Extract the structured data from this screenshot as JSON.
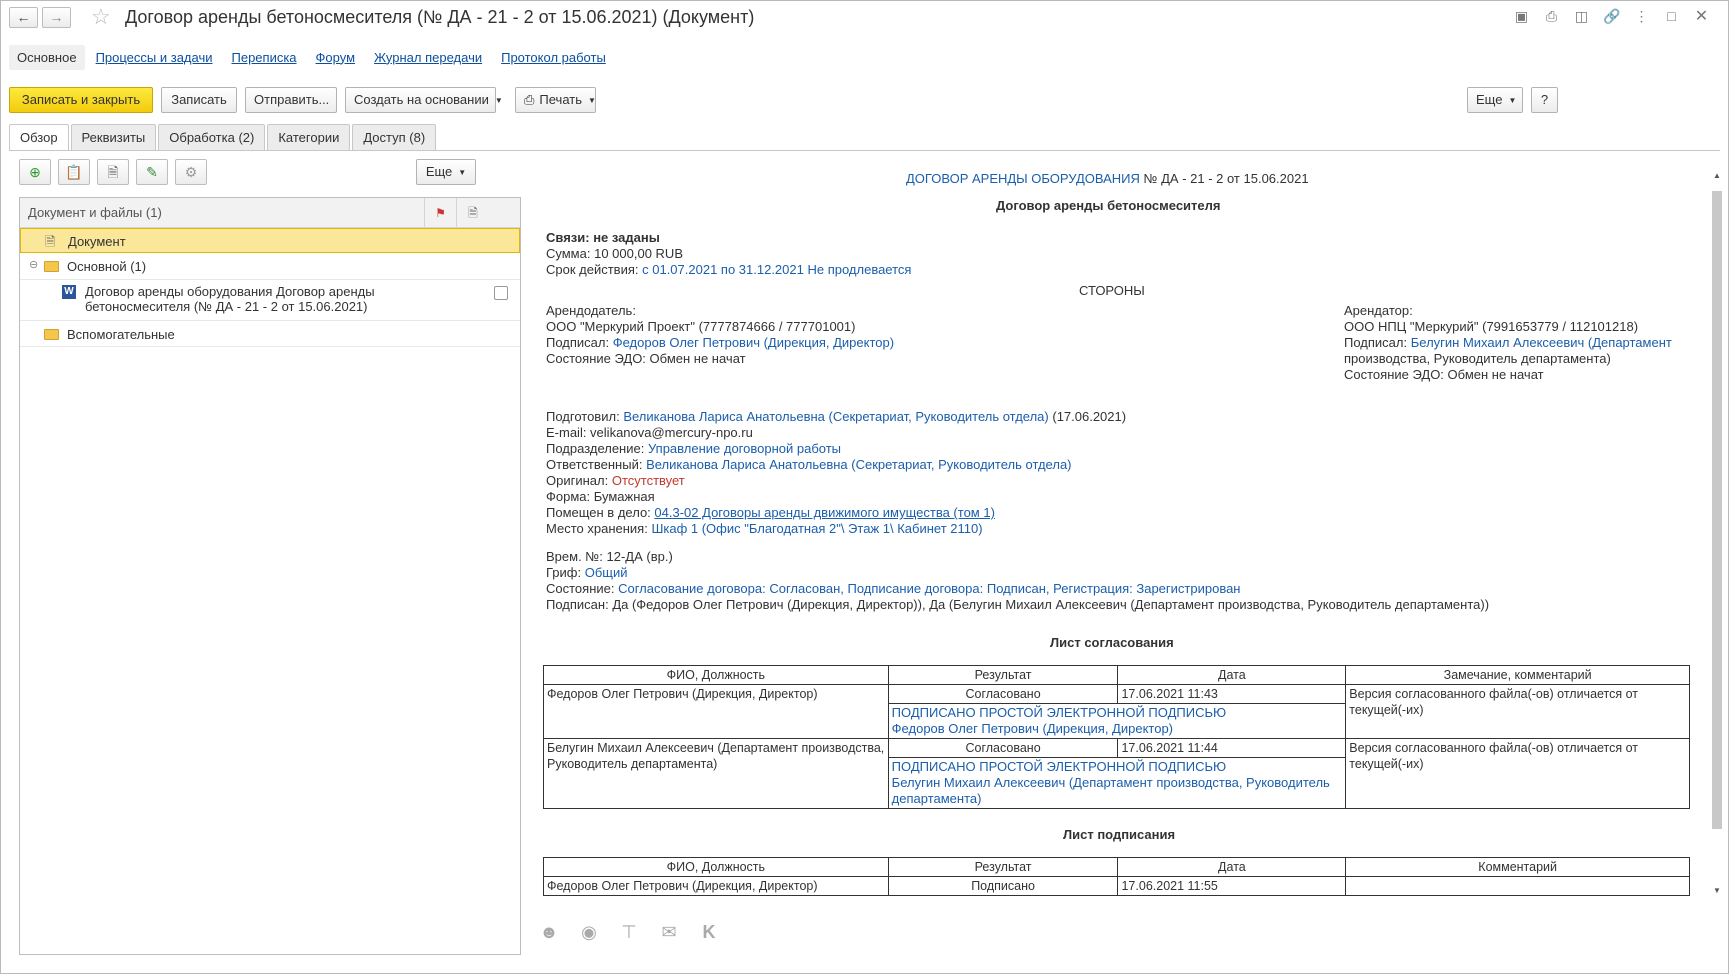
{
  "window": {
    "title": "Договор аренды бетоносмесителя (№ ДА - 21 - 2 от 15.06.2021) (Документ)"
  },
  "nav_tabs": [
    "Основное",
    "Процессы и задачи",
    "Переписка",
    "Форум",
    "Журнал передачи",
    "Протокол работы"
  ],
  "toolbar": {
    "save_close": "Записать и закрыть",
    "save": "Записать",
    "send": "Отправить...",
    "create_based": "Создать на основании",
    "print": "Печать",
    "more": "Еще",
    "help": "?"
  },
  "form_tabs": [
    "Обзор",
    "Реквизиты",
    "Обработка (2)",
    "Категории",
    "Доступ (8)"
  ],
  "left_panel": {
    "more": "Еще",
    "header": "Документ и файлы (1)",
    "rows": {
      "document": "Документ",
      "main": "Основной (1)",
      "file_line1": "Договор аренды оборудования Договор аренды",
      "file_line2": "бетоносмесителя (№ ДА - 21 - 2 от 15.06.2021)",
      "aux": "Вспомогательные"
    }
  },
  "doc": {
    "header_link": "ДОГОВОР АРЕНДЫ ОБОРУДОВАНИЯ",
    "header_rest": "№ ДА - 21 - 2 от 15.06.2021",
    "heading": "Договор аренды бетоносмесителя",
    "links": "Связи: не заданы",
    "sum_label": "Сумма:",
    "sum_value": "10 000,00 RUB",
    "term_label": "Срок действия:",
    "term_value": "с 01.07.2021 по 31.12.2021 Не продлевается",
    "parties": "СТОРОНЫ",
    "landlord_label": "Арендодатель:",
    "landlord_org": "ООО \"Меркурий Проект\" (7777874666 / 777701001)",
    "landlord_signed_label": "Подписал:",
    "landlord_signed": "Федоров Олег Петрович (Дирекция, Директор)",
    "landlord_edo_label": "Состояние ЭДО:",
    "landlord_edo": "Обмен не начат",
    "tenant_label": "Арендатор:",
    "tenant_org": "ООО НПЦ \"Меркурий\" (7991653779 / 112101218)",
    "tenant_signed_label": "Подписал:",
    "tenant_signed_1": "Белугин Михаил Алексеевич (Департамент",
    "tenant_signed_2": "производства, Руководитель департамента)",
    "tenant_edo_label": "Состояние ЭДО:",
    "tenant_edo": "Обмен не начат",
    "prepared_label": "Подготовил:",
    "prepared": "Великанова Лариса Анатольевна (Секретариат, Руководитель отдела)",
    "prepared_date": "(17.06.2021)",
    "email": "E-mail: velikanova@mercury-npo.ru",
    "dept_label": "Подразделение:",
    "dept": "Управление договорной работы",
    "resp_label": "Ответственный:",
    "resp": "Великанова Лариса Анатольевна (Секретариат, Руководитель отдела)",
    "orig_label": "Оригинал:",
    "orig": "Отсутствует",
    "form_label": "Форма:",
    "form": "Бумажная",
    "case_label": "Помещен в дело:",
    "case": "04.3-02 Договоры аренды движимого имущества (том 1)",
    "storage_label": "Место хранения:",
    "storage": "Шкаф 1 (Офис \"Благодатная 2\"\\ Этаж 1\\ Кабинет 2110)",
    "temp_label": "Врем. №:",
    "temp": "12-ДА (вр.)",
    "grif_label": "Гриф:",
    "grif": "Общий",
    "state_label": "Состояние:",
    "state": "Согласование договора: Согласован, Подписание договора: Подписан, Регистрация: Зарегистрирован",
    "signed_label": "Подписан:",
    "signed": "Да (Федоров Олег Петрович (Дирекция, Директор)), Да (Белугин Михаил Алексеевич (Департамент производства, Руководитель департамента))",
    "approval_title": "Лист согласования",
    "approval_headers": [
      "ФИО, Должность",
      "Результат",
      "Дата",
      "Замечание, комментарий"
    ],
    "approval_rows": [
      {
        "name": "Федоров Олег Петрович (Дирекция, Директор)",
        "result": "Согласовано",
        "date": "17.06.2021 11:43",
        "comment": "Версия согласованного файла(-ов) отличается от текущей(-их)",
        "sig1": "ПОДПИСАНО ПРОСТОЙ ЭЛЕКТРОННОЙ ПОДПИСЬЮ",
        "sig2": "Федоров Олег Петрович (Дирекция, Директор)"
      },
      {
        "name": "Белугин Михаил Алексеевич (Департамент производства, Руководитель департамента)",
        "result": "Согласовано",
        "date": "17.06.2021 11:44",
        "comment": "Версия согласованного файла(-ов) отличается от текущей(-их)",
        "sig1": "ПОДПИСАНО ПРОСТОЙ ЭЛЕКТРОННОЙ ПОДПИСЬЮ",
        "sig2": "Белугин Михаил Алексеевич (Департамент производства, Руководитель департамента)"
      }
    ],
    "signing_title": "Лист подписания",
    "signing_headers": [
      "ФИО, Должность",
      "Результат",
      "Дата",
      "Комментарий"
    ],
    "signing_row": {
      "name": "Федоров Олег Петрович (Дирекция, Директор)",
      "result": "Подписано",
      "date": "17.06.2021 11:55"
    }
  },
  "colors": {
    "accent_button": "#f5d21c",
    "link": "#1b5eab",
    "selected_row": "#fbe79a",
    "missing": "#c0392b"
  }
}
